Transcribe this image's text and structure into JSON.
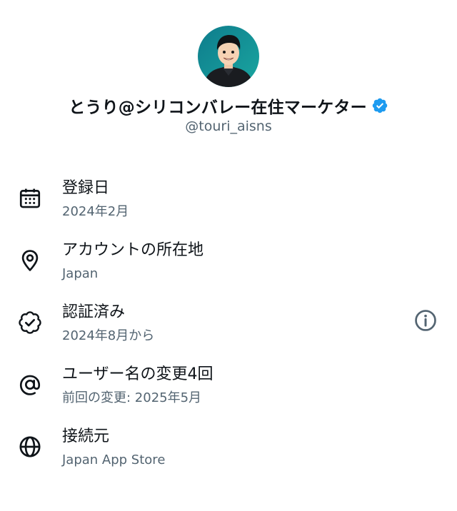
{
  "profile": {
    "display_name": "とうり@シリコンバレー在住マーケター",
    "handle": "@touri_aisns",
    "verified_color": "#1d9bf0"
  },
  "about": [
    {
      "icon": "calendar-icon",
      "title": "登録日",
      "subtitle": "2024年2月"
    },
    {
      "icon": "location-pin-icon",
      "title": "アカウントの所在地",
      "subtitle": "Japan"
    },
    {
      "icon": "verified-badge-icon",
      "title": "認証済み",
      "subtitle": "2024年8月から",
      "action_icon": "info-icon"
    },
    {
      "icon": "at-sign-icon",
      "title": "ユーザー名の変更4回",
      "subtitle": "前回の変更: 2025年5月"
    },
    {
      "icon": "globe-icon",
      "title": "接続元",
      "subtitle": "Japan App Store"
    }
  ],
  "colors": {
    "text_primary": "#0f1419",
    "text_secondary": "#536471",
    "accent": "#1d9bf0"
  }
}
